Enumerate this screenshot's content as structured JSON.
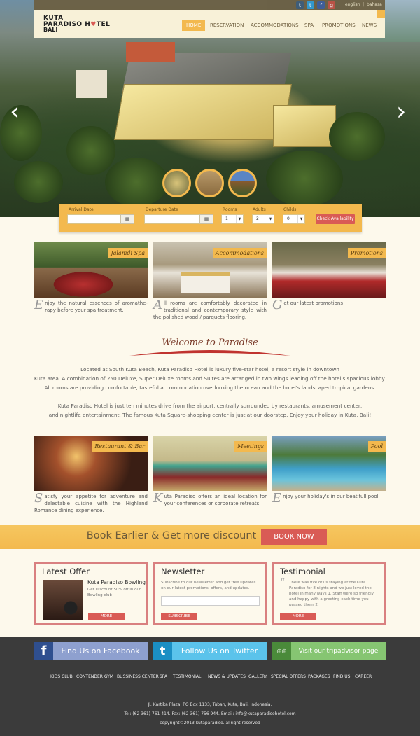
{
  "topbar": {
    "social": [
      {
        "icon": "tumblr-icon",
        "glyph": "t",
        "color": "#3a5874"
      },
      {
        "icon": "twitter-icon",
        "glyph": "t",
        "color": "#2d9ad1"
      },
      {
        "icon": "facebook-icon",
        "glyph": "f",
        "color": "#3b5998"
      },
      {
        "icon": "googleplus-icon",
        "glyph": "g",
        "color": "#c24d3d"
      }
    ],
    "lang_english": "english",
    "lang_sep": "|",
    "lang_bahasa": "bahasa"
  },
  "brand": {
    "line1": "KUTA",
    "line1b": "PARADISO H",
    "line1c": "TEL",
    "line2": "BALI"
  },
  "nav": [
    {
      "label": "HOME",
      "active": true
    },
    {
      "label": "RESERVATION"
    },
    {
      "label": "ACCOMMODATIONS"
    },
    {
      "label": "SPA"
    },
    {
      "label": "PROMOTIONS"
    },
    {
      "label": "NEWS"
    }
  ],
  "hero": {
    "prev_icon": "chevron-left-icon",
    "next_icon": "chevron-right-icon",
    "prev": "‹",
    "next": "›"
  },
  "booking": {
    "arrival_label": "Arrival Date",
    "departure_label": "Departure Date",
    "rooms_label": "Rooms",
    "adults_label": "Adults",
    "childs_label": "Childs",
    "rooms_value": "1",
    "adults_value": "2",
    "childs_value": "0",
    "check_label": "Check Availability"
  },
  "cards_top": [
    {
      "label": "Jalanidi Spa",
      "cap": "E",
      "text": "njoy the natural essences of aromathe-rapy before your spa treatment."
    },
    {
      "label": "Accommodations",
      "cap": "A",
      "text": "ll rooms are comfortably decorated in traditional and contemporary style with the polished wood / parquets flooring."
    },
    {
      "label": "Promotions",
      "cap": "G",
      "text": "et our latest promotions"
    }
  ],
  "welcome": {
    "title": "Welcome to Paradise",
    "p1a": "Located at South Kuta Beach, Kuta Paradiso Hotel is luxury five-star hotel, a resort style in downtown",
    "p1b": "Kuta area. A combination of 250 Deluxe, Super Deluxe rooms and Suites are arranged in two wings leading off the hotel's spacious lobby.",
    "p1c": "All rooms are providing comfortable, tasteful accommodation overlooking the ocean and the hotel's landscaped tropical gardens.",
    "p2a": "Kuta Paradiso Hotel is just ten minutes drive from the airport, centrally surrounded by restaurants, amusement center,",
    "p2b": "and nightlife entertainment. The famous Kuta Square-shopping center is just at our doorstep. Enjoy your holiday in Kuta, Bali!"
  },
  "cards_bottom": [
    {
      "label": "Restaurant & Bar",
      "cap": "S",
      "text": "atisfy your appetite for adventure and delectable cuisine with the Highland Romance dining experience."
    },
    {
      "label": "Meetings",
      "cap": "K",
      "text": "uta Paradiso offers an ideal location for your conferences or corporate retreats."
    },
    {
      "label": "Pool",
      "cap": "E",
      "text": "njoy your holiday's in our beatifull pool"
    }
  ],
  "promo": {
    "text": "Book Earlier & Get more discount",
    "button": "BOOK NOW"
  },
  "offer": {
    "title": "Latest Offer",
    "item_title": "Kuta Paradiso Bowling",
    "item_text": "Get Discount 50% off in our Bowling club",
    "button": "MORE"
  },
  "newsletter": {
    "title": "Newsletter",
    "text": "Subscribe to our newsletter and get free updates on our latest promotions, offers, and updates.",
    "placeholder": "",
    "button": "SUBSCRIBE"
  },
  "testimonial": {
    "title": "Testimonial",
    "quote_mark": "“",
    "text": "There was five of us staying at the Kuta Paradiso for 8 nights and we just loved the hotel in many ways 1. Staff were so friendly and happy with a greeting each time you passed them 2.",
    "button": "MORE"
  },
  "social_buttons": [
    {
      "label": "Find Us on Facebook",
      "icon": "facebook-icon",
      "glyph": "f",
      "icon_bg": "#2f4f8f",
      "bg": "#8ea0cf"
    },
    {
      "label": "Follow Us on Twitter",
      "icon": "twitter-icon",
      "glyph": "t",
      "icon_bg": "#1b8fc4",
      "bg": "#5bc3eb"
    },
    {
      "label": "Visit our tripadvisor page",
      "icon": "tripadvisor-icon",
      "glyph": "◎◎",
      "icon_bg": "#4a8a3a",
      "bg": "#86c572"
    }
  ],
  "footer_links": [
    "KIDS CLUB",
    "CONTENDER GYM",
    "BUSSINESS CENTER",
    "SPA",
    "TESTIMONIAL",
    "NEWS & UPDATES",
    "GALLERY",
    "SPECIAL OFFERS",
    "PACKAGES",
    "FIND US",
    "CAREER"
  ],
  "footer": {
    "address": "Jl. Kartika Plaza, PO Box 1133, Tuban, Kuta, Bali, Indonesia.",
    "contact": "Tel: (62 361) 761 414. Fax: (62 361) 756 944. Email: info@kutaparadisohotel.com",
    "copyright": "copyright©2013 kutaparadiso. allright reserved"
  }
}
